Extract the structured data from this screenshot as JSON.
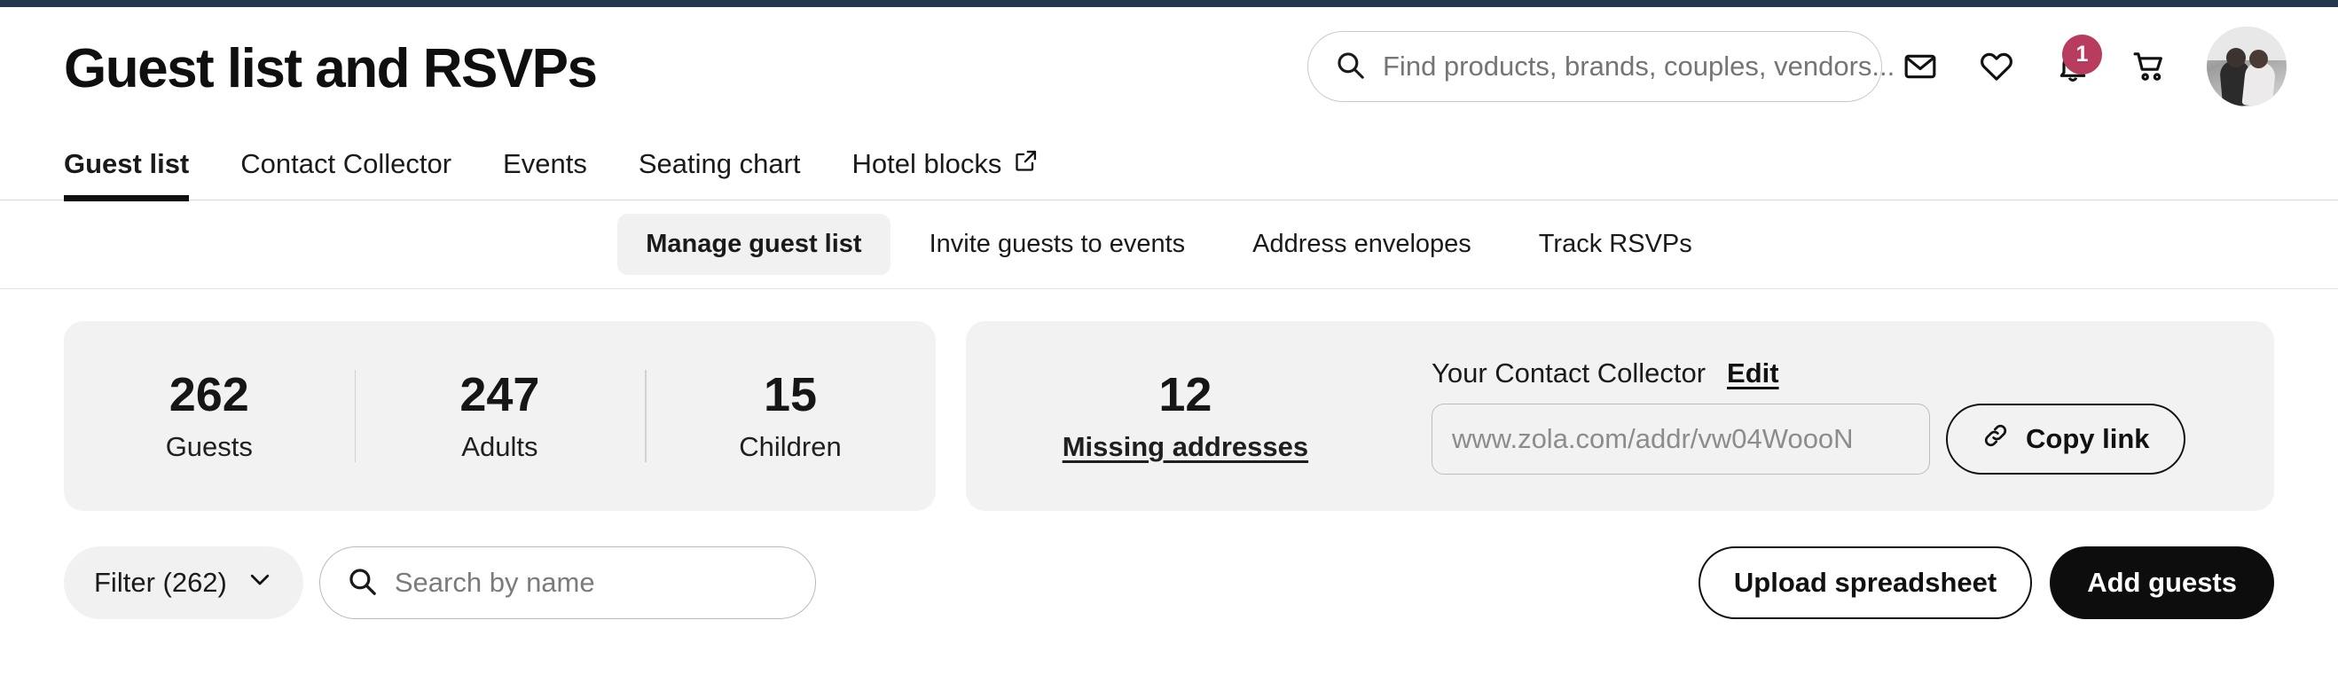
{
  "theme": {
    "accent_bar": "#24384d",
    "badge": "#b73c5e",
    "card_bg": "#f2f2f2",
    "pill_bg": "#f1f1f1",
    "primary_button": "#0d0d0d",
    "text": "#0f0f0f"
  },
  "header": {
    "title": "Guest list and RSVPs",
    "search": {
      "placeholder": "Find products, brands, couples, vendors...",
      "value": ""
    },
    "icons": [
      {
        "name": "mail-icon",
        "badge": null
      },
      {
        "name": "heart-icon",
        "badge": null
      },
      {
        "name": "bell-icon",
        "badge": "1"
      },
      {
        "name": "cart-icon",
        "badge": null
      }
    ],
    "avatar_alt": "User profile photo"
  },
  "tabs": [
    {
      "label": "Guest list",
      "active": true,
      "external": false
    },
    {
      "label": "Contact Collector",
      "active": false,
      "external": false
    },
    {
      "label": "Events",
      "active": false,
      "external": false
    },
    {
      "label": "Seating chart",
      "active": false,
      "external": false
    },
    {
      "label": "Hotel blocks",
      "active": false,
      "external": true
    }
  ],
  "subtabs": [
    {
      "label": "Manage guest list",
      "active": true
    },
    {
      "label": "Invite guests to events",
      "active": false
    },
    {
      "label": "Address envelopes",
      "active": false
    },
    {
      "label": "Track RSVPs",
      "active": false
    }
  ],
  "stats_card": {
    "stats": [
      {
        "value": "262",
        "label": "Guests",
        "link": false
      },
      {
        "value": "247",
        "label": "Adults",
        "link": false
      },
      {
        "value": "15",
        "label": "Children",
        "link": false
      }
    ]
  },
  "collector_card": {
    "missing": {
      "value": "12",
      "label": "Missing addresses",
      "link": true
    },
    "title": "Your Contact Collector",
    "edit_label": "Edit",
    "url_value": "www.zola.com/addr/vw04WoooN",
    "copy_label": "Copy link"
  },
  "controls": {
    "filter_label": "Filter (262)",
    "search_placeholder": "Search by name",
    "search_value": "",
    "upload_label": "Upload spreadsheet",
    "add_label": "Add guests"
  }
}
